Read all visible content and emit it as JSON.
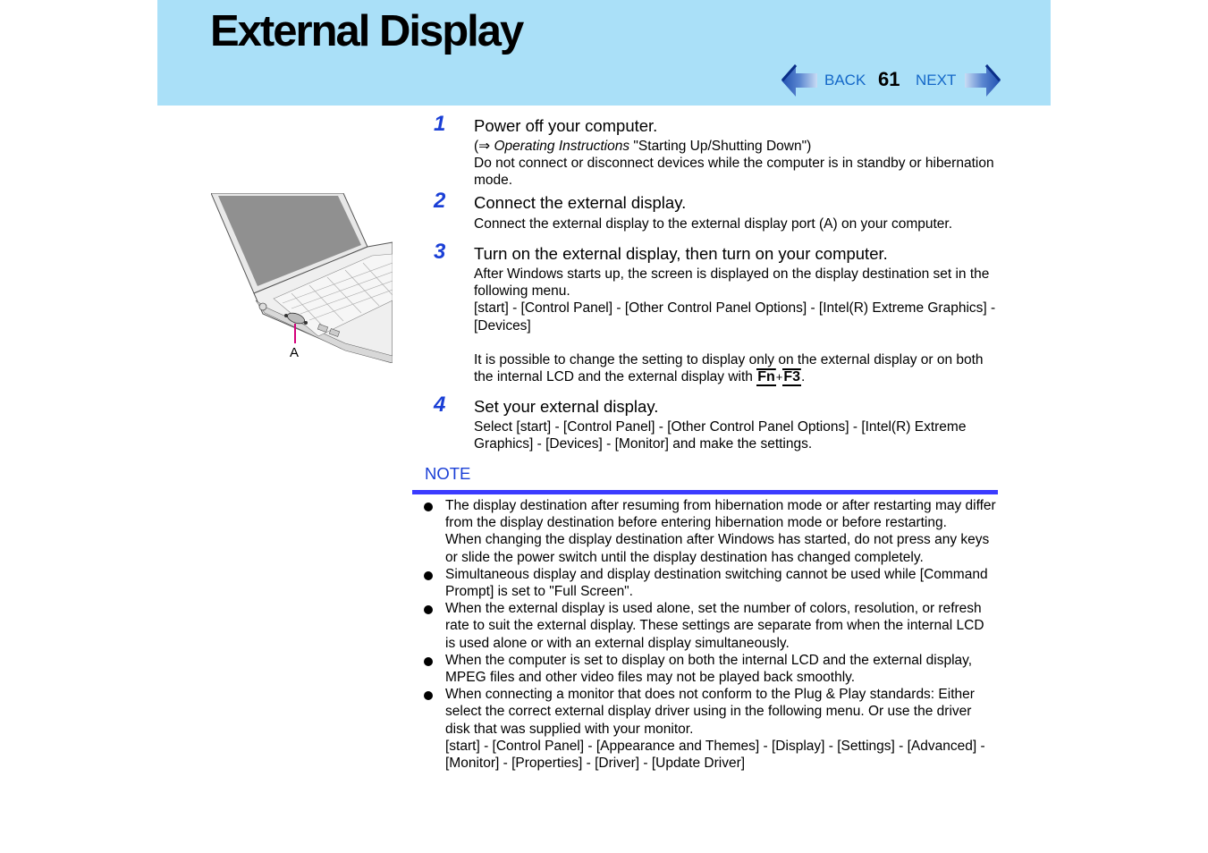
{
  "header": {
    "title": "External Display",
    "nav": {
      "back_label": "BACK",
      "page_number": "61",
      "next_label": "NEXT"
    },
    "colors": {
      "background": "#aae0f8",
      "nav_text": "#1468c8"
    }
  },
  "illustration": {
    "alt": "Laptop with external display port highlighted",
    "port_label": "A",
    "pointer_color": "#d4007a"
  },
  "steps": [
    {
      "number": "1",
      "title": "Power off your computer.",
      "ref_arrow": "(⇒ ",
      "ref_italic": "Operating Instructions",
      "ref_rest": " \"Starting Up/Shutting Down\")",
      "body": "Do not connect or disconnect devices while the computer is in standby or hibernation mode."
    },
    {
      "number": "2",
      "title": "Connect the external display.",
      "body": "Connect the external display to the external display port (A) on your computer."
    },
    {
      "number": "3",
      "title": "Turn on the external display, then turn on your computer.",
      "body1": "After Windows starts up, the screen is displayed on the display destination set in the following menu.",
      "body2": "[start] - [Control Panel] - [Other Control Panel Options] - [Intel(R) Extreme Graphics] - [Devices]",
      "body3": "It is possible to change the setting to display only on the external display or on both the internal LCD and the external display with ",
      "key1": "Fn",
      "key_plus": "+",
      "key2": "F3",
      "body3_end": "."
    },
    {
      "number": "4",
      "title": "Set your external display.",
      "body": "Select [start] - [Control Panel] - [Other Control Panel Options] - [Intel(R) Extreme Graphics] - [Devices] - [Monitor] and make the settings."
    }
  ],
  "note": {
    "label": "NOTE",
    "rule_color": "#3b3bff",
    "items": [
      {
        "p1": "The display destination after resuming from hibernation mode or after restarting may differ from the display destination before entering hibernation mode or before restarting.",
        "p2": "When changing the display destination after Windows has started, do not press any keys or slide the power switch until the display destination has changed completely."
      },
      {
        "p1": "Simultaneous display and display destination switching cannot be used while [Command Prompt] is set to \"Full Screen\"."
      },
      {
        "p1": "When the external display is used alone, set the number of colors, resolution, or refresh rate to suit the external display.  These settings are separate from when the internal LCD is used alone or with an external display simultaneously."
      },
      {
        "p1": "When the computer is set to display on both the internal LCD and the external display, MPEG files and other video files may not be played back smoothly."
      },
      {
        "p1": "When connecting a monitor that does not conform to the Plug & Play standards: Either select the correct external display driver using in the following menu.  Or use the driver disk that was supplied with your monitor.",
        "p2": "[start] - [Control Panel] - [Appearance and Themes] - [Display] - [Settings] - [Advanced] - [Monitor] - [Properties] - [Driver] - [Update Driver]"
      }
    ]
  }
}
